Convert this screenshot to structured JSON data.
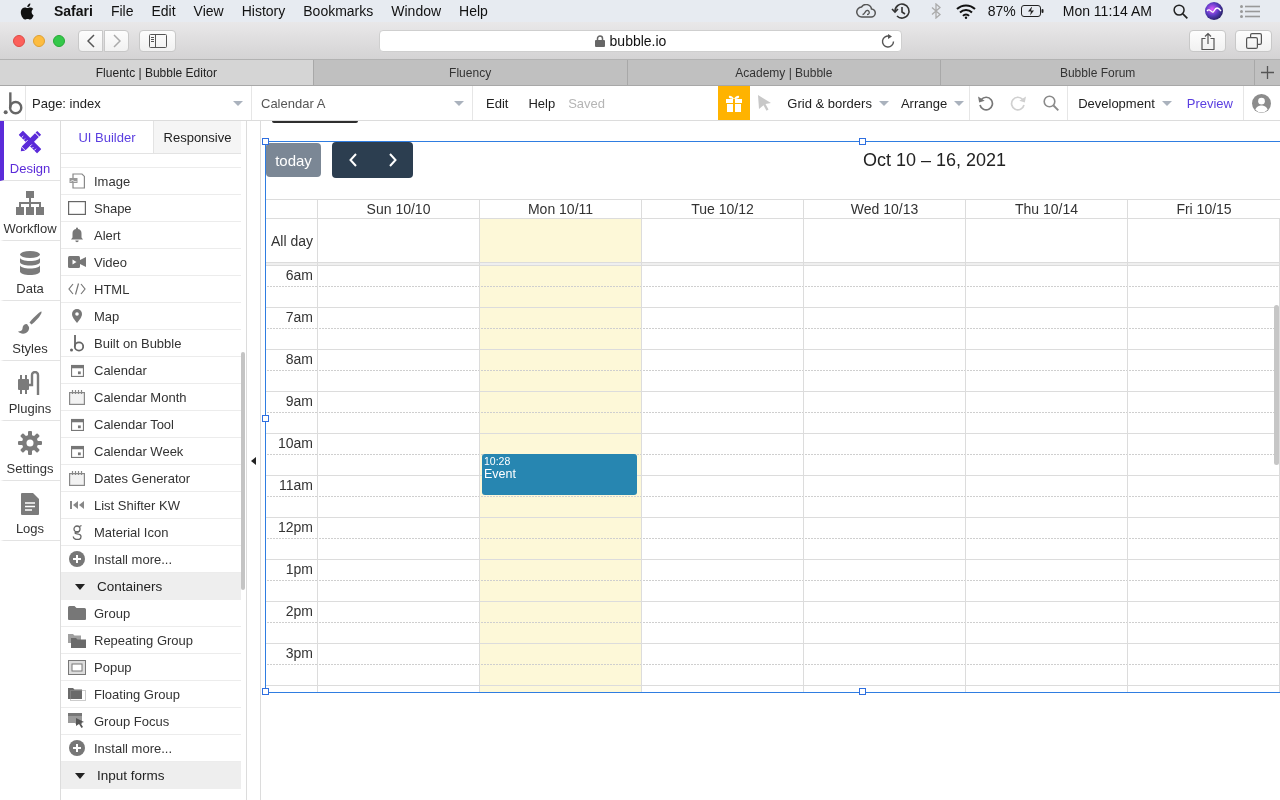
{
  "menu_bar": {
    "app": "Safari",
    "menus": [
      "File",
      "Edit",
      "View",
      "History",
      "Bookmarks",
      "Window",
      "Help"
    ],
    "battery": "87%",
    "clock": "Mon 11:14 AM"
  },
  "browser": {
    "address": "bubble.io",
    "tabs": [
      {
        "label": "Fluentc | Bubble Editor",
        "selected": true
      },
      {
        "label": "Fluency",
        "selected": false
      },
      {
        "label": "Academy | Bubble",
        "selected": false
      },
      {
        "label": "Bubble Forum",
        "selected": false
      }
    ]
  },
  "editor_bar": {
    "page": "Page: index",
    "element": "Calendar A",
    "menus": [
      "Edit",
      "Help"
    ],
    "save_status": "Saved",
    "grid_menu": "Grid & borders",
    "arrange_menu": "Arrange",
    "undo": {
      "disabled": false
    },
    "redo": {
      "disabled": true
    },
    "mode": "Development",
    "preview": "Preview"
  },
  "nav": [
    {
      "label": "Design",
      "selected": true
    },
    {
      "label": "Workflow",
      "selected": false
    },
    {
      "label": "Data",
      "selected": false
    },
    {
      "label": "Styles",
      "selected": false
    },
    {
      "label": "Plugins",
      "selected": false
    },
    {
      "label": "Settings",
      "selected": false
    },
    {
      "label": "Logs",
      "selected": false
    }
  ],
  "panel": {
    "tabs": [
      {
        "label": "UI Builder",
        "selected": true
      },
      {
        "label": "Responsive",
        "selected": false
      }
    ],
    "items": [
      {
        "kind": "element",
        "label": "Image"
      },
      {
        "kind": "element",
        "label": "Shape"
      },
      {
        "kind": "element",
        "label": "Alert"
      },
      {
        "kind": "element",
        "label": "Video"
      },
      {
        "kind": "element",
        "label": "HTML"
      },
      {
        "kind": "element",
        "label": "Map"
      },
      {
        "kind": "element",
        "label": "Built on Bubble"
      },
      {
        "kind": "element",
        "label": "Calendar"
      },
      {
        "kind": "element",
        "label": "Calendar Month"
      },
      {
        "kind": "element",
        "label": "Calendar Tool"
      },
      {
        "kind": "element",
        "label": "Calendar Week"
      },
      {
        "kind": "element",
        "label": "Dates Generator"
      },
      {
        "kind": "element",
        "label": "List Shifter KW"
      },
      {
        "kind": "element",
        "label": "Material Icon"
      },
      {
        "kind": "install",
        "label": "Install more..."
      },
      {
        "kind": "header",
        "label": "Containers",
        "expanded": true
      },
      {
        "kind": "element",
        "label": "Group"
      },
      {
        "kind": "element",
        "label": "Repeating Group"
      },
      {
        "kind": "element",
        "label": "Popup"
      },
      {
        "kind": "element",
        "label": "Floating Group"
      },
      {
        "kind": "element",
        "label": "Group Focus"
      },
      {
        "kind": "install",
        "label": "Install more..."
      },
      {
        "kind": "header",
        "label": "Input forms",
        "expanded": true
      }
    ]
  },
  "calendar": {
    "today_button": "today",
    "title": "Oct 10 – 16, 2021",
    "all_day_label": "All day",
    "hours": [
      "6am",
      "7am",
      "8am",
      "9am",
      "10am",
      "11am",
      "12pm",
      "1pm",
      "2pm",
      "3pm"
    ],
    "days": [
      {
        "label": "Sun 10/10",
        "highlighted": false
      },
      {
        "label": "Mon 10/11",
        "highlighted": true,
        "events": [
          {
            "time": "10:28",
            "title": "Event"
          }
        ]
      },
      {
        "label": "Tue 10/12",
        "highlighted": false
      },
      {
        "label": "Wed 10/13",
        "highlighted": false
      },
      {
        "label": "Thu 10/14",
        "highlighted": false
      },
      {
        "label": "Fri 10/15",
        "highlighted": false
      }
    ]
  }
}
